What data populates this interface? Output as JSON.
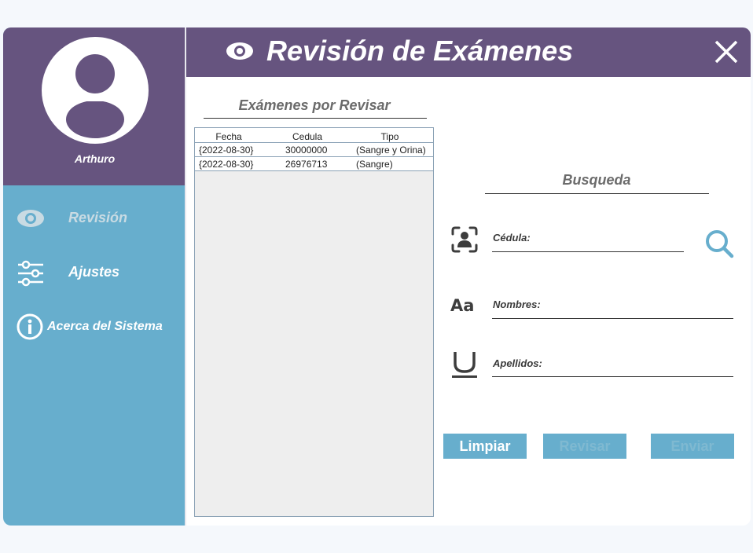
{
  "user": {
    "name": "Arthuro"
  },
  "sidebar": {
    "items": [
      {
        "label": "Revisión",
        "icon": "eye-icon",
        "active": true
      },
      {
        "label": "Ajustes",
        "icon": "sliders-icon"
      },
      {
        "label": "Acerca del Sistema",
        "icon": "info-icon"
      }
    ]
  },
  "header": {
    "title": "Revisión de Exámenes"
  },
  "exams": {
    "title": "Exámenes por Revisar",
    "columns": [
      "Fecha",
      "Cedula",
      "Tipo"
    ],
    "rows": [
      [
        "{2022-08-30}",
        "30000000",
        "(Sangre y Orina)"
      ],
      [
        "{2022-08-30}",
        "26976713",
        "(Sangre)"
      ]
    ]
  },
  "search": {
    "title": "Busqueda",
    "cedula_label": "Cédula:",
    "nombres_label": "Nombres:",
    "apellidos_label": "Apellidos:"
  },
  "buttons": {
    "clear": "Limpiar",
    "review": "Revisar",
    "send": "Enviar"
  },
  "colors": {
    "purple": "#66547f",
    "blue": "#67aecd"
  }
}
